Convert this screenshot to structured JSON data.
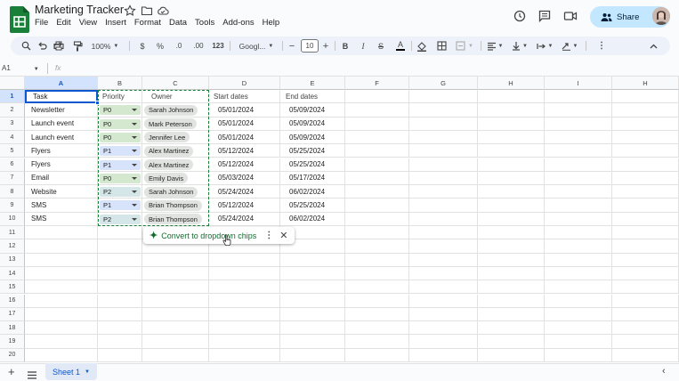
{
  "app": {
    "title": "Marketing Tracker",
    "share_label": "Share",
    "name_box": "A1",
    "fx_label": "fx"
  },
  "menu": [
    "File",
    "Edit",
    "View",
    "Insert",
    "Format",
    "Data",
    "Tools",
    "Add-ons",
    "Help"
  ],
  "toolbar": {
    "zoom": "100%",
    "currency": "$",
    "percent": "%",
    "dec_less": ".0",
    "dec_more": ".00",
    "number_format": "123",
    "font": "Googl...",
    "font_size": "10"
  },
  "columns": [
    "A",
    "B",
    "C",
    "D",
    "E",
    "F",
    "G",
    "H",
    "I",
    "H"
  ],
  "rows": [
    "1",
    "2",
    "3",
    "4",
    "5",
    "6",
    "7",
    "8",
    "9",
    "10",
    "11",
    "12",
    "13",
    "14",
    "15",
    "16",
    "17",
    "18",
    "19",
    "20"
  ],
  "headers": {
    "task": "Task",
    "priority": "Priority",
    "owner": "Owner",
    "start": "Start dates",
    "end": "End dates"
  },
  "data": [
    {
      "task": "Newsletter",
      "priority": "P0",
      "owner": "Sarah Johnson",
      "start": "05/01/2024",
      "end": "05/09/2024"
    },
    {
      "task": "Launch event",
      "priority": "P0",
      "owner": "Mark Peterson",
      "start": "05/01/2024",
      "end": "05/09/2024"
    },
    {
      "task": "Launch event",
      "priority": "P0",
      "owner": "Jennifer Lee",
      "start": "05/01/2024",
      "end": "05/09/2024"
    },
    {
      "task": "Flyers",
      "priority": "P1",
      "owner": "Alex Martinez",
      "start": "05/12/2024",
      "end": "05/25/2024"
    },
    {
      "task": "Flyers",
      "priority": "P1",
      "owner": "Alex Martinez",
      "start": "05/12/2024",
      "end": "05/25/2024"
    },
    {
      "task": "Email",
      "priority": "P0",
      "owner": "Emily Davis",
      "start": "05/03/2024",
      "end": "05/17/2024"
    },
    {
      "task": "Website",
      "priority": "P2",
      "owner": "Sarah Johnson",
      "start": "05/24/2024",
      "end": "06/02/2024"
    },
    {
      "task": "SMS",
      "priority": "P1",
      "owner": "Brian Thompson",
      "start": "05/12/2024",
      "end": "05/25/2024"
    },
    {
      "task": "SMS",
      "priority": "P2",
      "owner": "Brian Thompson",
      "start": "05/24/2024",
      "end": "06/02/2024"
    }
  ],
  "priority_colors": {
    "P0": "#d3e8cf",
    "P1": "#d6e3fa",
    "P2": "#d4e6e8"
  },
  "popup": {
    "label": "Convert to dropdown chips"
  },
  "sheet": {
    "tab": "Sheet 1"
  },
  "colors": {
    "accent": "#0b57d0",
    "share_bg": "#c2e7ff",
    "logo": "#188038",
    "popup_text": "#146c2e"
  }
}
